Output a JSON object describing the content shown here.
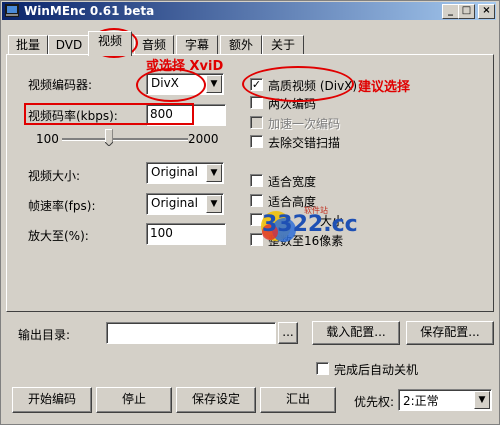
{
  "window": {
    "title": "WinMEnc 0.61 beta",
    "minimize": "_",
    "maximize": "□",
    "close": "×"
  },
  "tabs": [
    "批量",
    "DVD",
    "视频",
    "音频",
    "字幕",
    "额外",
    "关于"
  ],
  "video": {
    "codec_label": "视频编码器:",
    "codec_value": "DivX",
    "bitrate_label": "视频码率(kbps):",
    "bitrate_value": "800",
    "slider_min": "100",
    "slider_max": "2000",
    "slider_fraction": 0.37,
    "size_label": "视频大小:",
    "size_value": "Original",
    "fps_label": "帧速率(fps):",
    "fps_value": "Original",
    "zoom_label": "放大至(%):",
    "zoom_value": "100"
  },
  "options": {
    "high_quality": {
      "label": "高质视频 (DivX)",
      "checked": true
    },
    "two_pass": {
      "label": "两次编码",
      "checked": false
    },
    "one_pass_speed": {
      "label": "加速一次编码",
      "checked": false
    },
    "deinterlace": {
      "label": "去除交错扫描",
      "checked": false
    },
    "fit_width": {
      "label": "适合宽度",
      "checked": false
    },
    "fit_height": {
      "label": "适合高度",
      "checked": false
    },
    "size_opt": {
      "label": "大小",
      "checked": false
    },
    "pixel_opt": {
      "label": "整数至16像素",
      "checked": false
    }
  },
  "annotations": {
    "alt_hint": "或选择 XviD",
    "recommend": "建议选择"
  },
  "watermark": {
    "text": "3322.cc",
    "sub": "软件站"
  },
  "output": {
    "label": "输出目录:",
    "value": "",
    "browse": "...",
    "load_config": "载入配置...",
    "save_config": "保存配置...",
    "shutdown_label": "完成后自动关机"
  },
  "bottom": {
    "start": "开始编码",
    "stop": "停止",
    "save_settings": "保存设定",
    "export": "汇出",
    "priority_label": "优先权:",
    "priority_value": "2:正常"
  }
}
